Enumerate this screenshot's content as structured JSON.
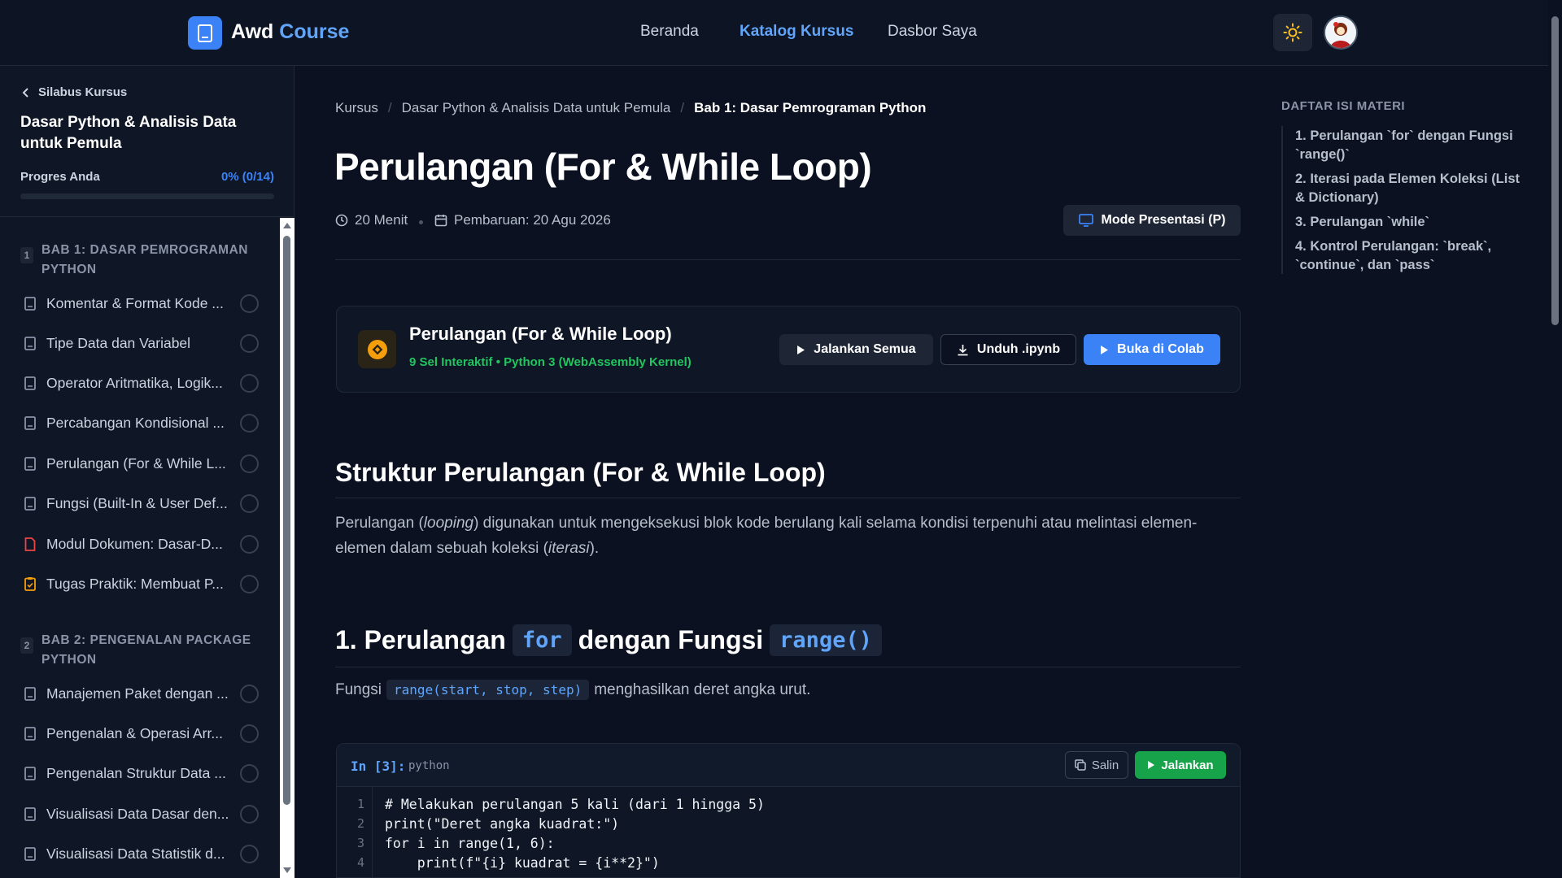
{
  "header": {
    "logo_main": "Awd",
    "logo_accent": "Course",
    "nav": [
      "Beranda",
      "Katalog Kursus",
      "Dasbor Saya"
    ],
    "active_nav": "Katalog Kursus"
  },
  "sidebar": {
    "back_label": "Silabus Kursus",
    "course_title": "Dasar Python & Analisis Data untuk Pemula",
    "progress_label": "Progres Anda",
    "progress_value": "0% (0/14)",
    "progress_fraction": 0,
    "chapters": [
      {
        "num": "1",
        "title": "BAB 1: DASAR PEMROGRAMAN PYTHON",
        "lessons": [
          {
            "label": "Komentar & Format Kode ...",
            "icon": "book-icon"
          },
          {
            "label": "Tipe Data dan Variabel",
            "icon": "book-icon"
          },
          {
            "label": "Operator Aritmatika, Logik...",
            "icon": "book-icon"
          },
          {
            "label": "Percabangan Kondisional ...",
            "icon": "book-icon"
          },
          {
            "label": "Perulangan (For & While L...",
            "icon": "book-icon"
          },
          {
            "label": "Fungsi (Built-In & User Def...",
            "icon": "book-icon"
          },
          {
            "label": "Modul Dokumen: Dasar-D...",
            "icon": "pdf-file-icon"
          },
          {
            "label": "Tugas Praktik: Membuat P...",
            "icon": "clipboard-icon"
          }
        ]
      },
      {
        "num": "2",
        "title": "BAB 2: PENGENALAN PACKAGE PYTHON",
        "lessons": [
          {
            "label": "Manajemen Paket dengan ...",
            "icon": "book-icon"
          },
          {
            "label": "Pengenalan & Operasi Arr...",
            "icon": "book-icon"
          },
          {
            "label": "Pengenalan Struktur Data ...",
            "icon": "book-icon"
          },
          {
            "label": "Visualisasi Data Dasar den...",
            "icon": "book-icon"
          },
          {
            "label": "Visualisasi Data Statistik d...",
            "icon": "book-icon"
          }
        ]
      }
    ]
  },
  "breadcrumb": [
    "Kursus",
    "Dasar Python & Analisis Data untuk Pemula",
    "Bab 1: Dasar Pemrograman Python"
  ],
  "page": {
    "title": "Perulangan (For & While Loop)",
    "duration": "20 Menit",
    "updated": "Pembaruan: 20 Agu 2026",
    "mode_button": "Mode Presentasi (P)"
  },
  "notebook": {
    "title": "Perulangan (For & While Loop)",
    "subtitle": "9 Sel Interaktif • Python 3 (WebAssembly Kernel)",
    "run_all": "Jalankan Semua",
    "download": "Unduh .ipynb",
    "colab": "Buka di Colab"
  },
  "content": {
    "h2": "Struktur Perulangan (For & While Loop)",
    "intro": {
      "t1": "Perulangan (",
      "em1": "looping",
      "t2": ") digunakan untuk mengeksekusi blok kode berulang kali selama kondisi terpenuhi atau melintasi elemen-elemen dalam sebuah koleksi (",
      "em2": "iterasi",
      "t3": ")."
    },
    "h3": {
      "pre": "1. Perulangan",
      "code1": "for",
      "mid": "dengan Fungsi",
      "code2": "range()"
    },
    "para2": {
      "pre": "Fungsi",
      "code": "range(start, stop, step)",
      "post": "menghasilkan deret angka urut."
    }
  },
  "code_cell": {
    "prompt": "In [3]:",
    "lang": "python",
    "copy": "Salin",
    "run": "Jalankan",
    "lines": [
      {
        "n": "1",
        "code": "# Melakukan perulangan 5 kali (dari 1 hingga 5)"
      },
      {
        "n": "2",
        "code": "print(\"Deret angka kuadrat:\")"
      },
      {
        "n": "3",
        "code": "for i in range(1, 6):"
      },
      {
        "n": "4",
        "code": "    print(f\"{i} kuadrat = {i**2}\")"
      }
    ]
  },
  "toc": {
    "title": "DAFTAR ISI MATERI",
    "items": [
      "1. Perulangan `for` dengan Fungsi `range()`",
      "2. Iterasi pada Elemen Koleksi (List & Dictionary)",
      "3. Perulangan `while`",
      "4. Kontrol Perulangan: `break`, `continue`, dan `pass`"
    ]
  },
  "colors": {
    "accent": "#3b82f6",
    "success": "#22c55e",
    "run_button": "#16a34a",
    "background": "#0b1120"
  }
}
